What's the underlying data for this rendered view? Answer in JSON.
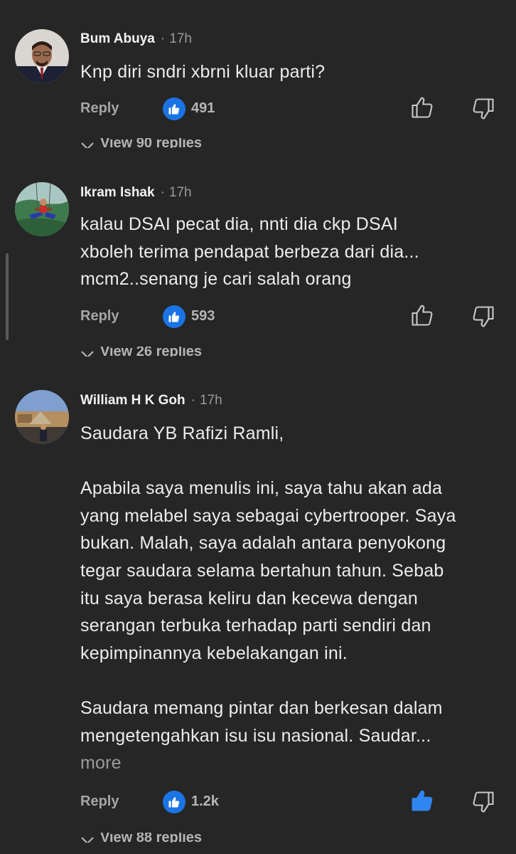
{
  "comments": [
    {
      "author": "Bum Abuya",
      "time": "17h",
      "lines": [
        "Knp diri sndri xbrni kluar parti?"
      ],
      "reply_label": "Reply",
      "like_count": "491",
      "view_replies": "View 90 replies",
      "liked": false
    },
    {
      "author": "Ikram Ishak",
      "time": "17h",
      "lines": [
        "kalau DSAI pecat dia, nnti dia ckp DSAI",
        "xboleh terima pendapat berbeza dari dia...",
        "mcm2..senang je cari salah orang"
      ],
      "reply_label": "Reply",
      "like_count": "593",
      "view_replies": "View 26 replies",
      "liked": false
    },
    {
      "author": "William H K Goh",
      "time": "17h",
      "lines": [
        "Saudara YB Rafizi Ramli,",
        "",
        "Apabila saya menulis ini, saya tahu akan ada",
        "yang melabel saya sebagai cybertrooper. Saya",
        "bukan. Malah, saya adalah antara penyokong",
        "tegar saudara selama bertahun tahun. Sebab",
        "itu saya berasa keliru dan kecewa dengan",
        "serangan terbuka terhadap parti sendiri dan",
        "kepimpinannya kebelakangan ini.",
        "",
        "Saudara memang pintar dan berkesan dalam",
        "mengetengahkan isu isu nasional. Saudar..."
      ],
      "more_label": "more",
      "reply_label": "Reply",
      "like_count": "1.2k",
      "view_replies": "View 88 replies",
      "liked": true
    }
  ],
  "colors": {
    "background": "#262626",
    "like_blue": "#1b74e4",
    "muted": "#9a9a9a"
  },
  "icons": {
    "like_badge": "thumbs-up-icon",
    "upvote": "thumb-up-icon",
    "downvote": "thumb-down-icon",
    "expand": "chevron-down-icon"
  }
}
